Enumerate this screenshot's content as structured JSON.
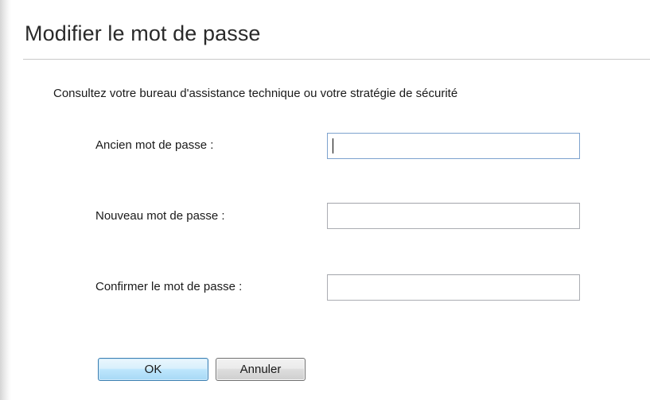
{
  "dialog": {
    "title": "Modifier le mot de passe",
    "description": "Consultez votre bureau d'assistance technique ou votre stratégie de sécurité"
  },
  "form": {
    "old_password": {
      "label": "Ancien mot de passe :",
      "value": "",
      "placeholder": "",
      "focused": true
    },
    "new_password": {
      "label": "Nouveau mot de passe :",
      "value": "",
      "placeholder": ""
    },
    "confirm_password": {
      "label": "Confirmer le mot de passe :",
      "value": "",
      "placeholder": ""
    }
  },
  "buttons": {
    "ok_label": "OK",
    "cancel_label": "Annuler"
  },
  "colors": {
    "ok_border": "#3c7fb1",
    "ok_fill": "#bee6fd",
    "input_border": "#abadb3",
    "rule": "#c9c9c9"
  }
}
